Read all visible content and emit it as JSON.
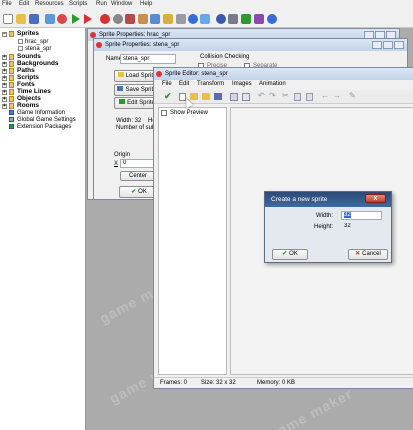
{
  "menubar": {
    "items": [
      "File",
      "Edit",
      "Resources",
      "Scripts",
      "Run",
      "Window",
      "Help"
    ]
  },
  "resource_tree": {
    "items": [
      {
        "label": "Sprites",
        "bold": true,
        "toggle": "−"
      },
      {
        "label": "hrac_spr",
        "bold": false
      },
      {
        "label": "stena_spr",
        "bold": false
      },
      {
        "label": "Sounds",
        "bold": true,
        "toggle": "+"
      },
      {
        "label": "Backgrounds",
        "bold": true,
        "toggle": "+"
      },
      {
        "label": "Paths",
        "bold": true,
        "toggle": "+"
      },
      {
        "label": "Scripts",
        "bold": true,
        "toggle": "+"
      },
      {
        "label": "Fonts",
        "bold": true,
        "toggle": "+"
      },
      {
        "label": "Time Lines",
        "bold": true,
        "toggle": "+"
      },
      {
        "label": "Objects",
        "bold": true,
        "toggle": "+"
      },
      {
        "label": "Rooms",
        "bold": true,
        "toggle": "+"
      },
      {
        "label": "Game Information",
        "bold": false
      },
      {
        "label": "Global Game Settings",
        "bold": false
      },
      {
        "label": "Extension Packages",
        "bold": false
      }
    ]
  },
  "win_hrac": {
    "title": "Sprite Properties: hrac_spr"
  },
  "win_stena": {
    "title": "Sprite Properties: stena_spr",
    "name_label": "Name:",
    "name_value": "stena_spr",
    "load_button": "Load Sprite",
    "save_button": "Save Sprite",
    "edit_button": "Edit Sprite",
    "width_label": "Width: 32",
    "height_label": "He",
    "subimages_label": "Number of subim",
    "origin_label": "Origin",
    "x_label": "X",
    "x_value": "0",
    "center_button": "Center",
    "ok_button": "OK",
    "collision_label": "Collision Checking",
    "precise_label": "Precise",
    "separate_label": "Separate"
  },
  "sprite_editor": {
    "title": "Sprite Editor: stena_spr",
    "menu": [
      "File",
      "Edit",
      "Transform",
      "Images",
      "Animation"
    ],
    "show_preview": "Show Preview",
    "status": {
      "frames": "Frames: 0",
      "size": "Size: 32 x 32",
      "memory": "Memory: 0 KB"
    }
  },
  "dialog": {
    "title": "Create a new sprite",
    "close": "x",
    "width_label": "Width:",
    "width_value": "32",
    "height_label": "Height:",
    "height_value": "32",
    "ok": "OK",
    "cancel": "Cancel"
  },
  "watermark": "game maker",
  "colors": {
    "accent": "#3e6aa3",
    "ok_check": "#2e9a2e",
    "cancel_x": "#c42a1c"
  }
}
